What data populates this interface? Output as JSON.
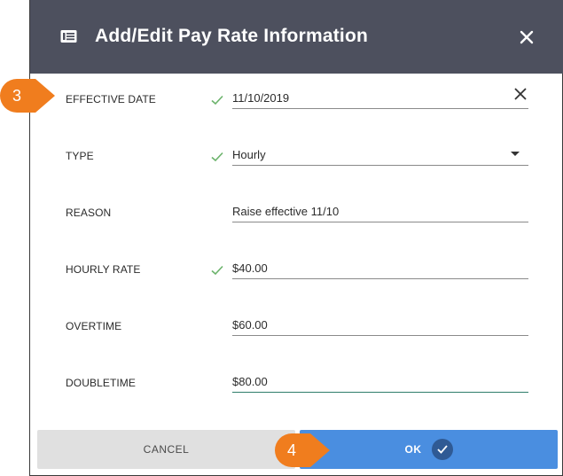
{
  "dialog": {
    "title": "Add/Edit Pay Rate Information",
    "title_icon": "id-card-icon",
    "close_icon": "close-icon"
  },
  "fields": {
    "effective_date": {
      "label": "EFFECTIVE DATE",
      "value": "11/10/2019",
      "valid": true
    },
    "type": {
      "label": "TYPE",
      "value": "Hourly",
      "valid": true
    },
    "reason": {
      "label": "REASON",
      "value": "Raise effective 11/10",
      "valid": false
    },
    "hourly_rate": {
      "label": "HOURLY RATE",
      "value": "$40.00",
      "valid": true
    },
    "overtime": {
      "label": "OVERTIME",
      "value": "$60.00",
      "valid": false
    },
    "doubletime": {
      "label": "DOUBLETIME",
      "value": "$80.00",
      "valid": false
    }
  },
  "buttons": {
    "cancel_label": "CANCEL",
    "ok_label": "OK"
  },
  "callouts": {
    "step_3": "3",
    "step_4": "4"
  },
  "colors": {
    "header_bg": "#4d505e",
    "ok_button": "#4a8ee0",
    "cancel_button": "#e0e0e0",
    "valid_check": "#6bb36b",
    "callout": "#f07d1e"
  }
}
